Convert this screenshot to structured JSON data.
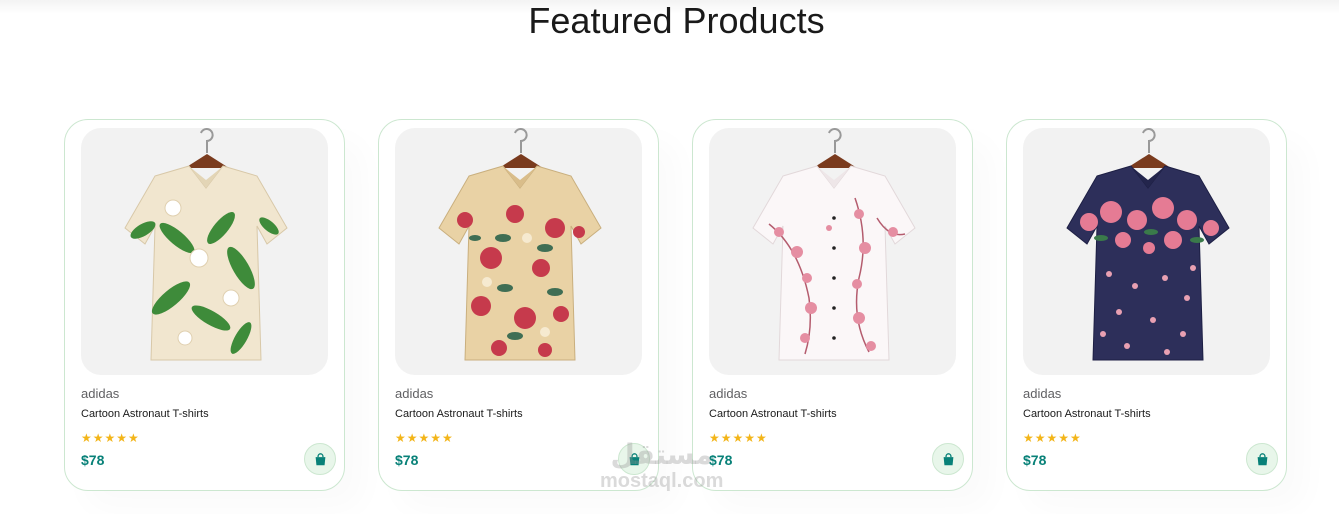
{
  "section": {
    "title": "Featured Products"
  },
  "products": [
    {
      "brand": "adidas",
      "name": "Cartoon Astronaut T-shirts",
      "stars": "★★★★★",
      "rating": 5,
      "price": "$78",
      "image": "shirt-tropical-leaves"
    },
    {
      "brand": "adidas",
      "name": "Cartoon Astronaut T-shirts",
      "stars": "★★★★★",
      "rating": 5,
      "price": "$78",
      "image": "shirt-beige-floral"
    },
    {
      "brand": "adidas",
      "name": "Cartoon Astronaut T-shirts",
      "stars": "★★★★★",
      "rating": 5,
      "price": "$78",
      "image": "shirt-white-blossom"
    },
    {
      "brand": "adidas",
      "name": "Cartoon Astronaut T-shirts",
      "stars": "★★★★★",
      "rating": 5,
      "price": "$78",
      "image": "shirt-navy-rose"
    }
  ],
  "icons": {
    "cart": "shopping-bag-icon",
    "rating": "star-icon"
  },
  "colors": {
    "accent": "#088178",
    "star": "#f3b519",
    "border": "#cce7d0",
    "cart_bg": "#e8f6ea"
  },
  "watermark": {
    "arabic": "مستقل",
    "latin": "mostaql.com"
  }
}
